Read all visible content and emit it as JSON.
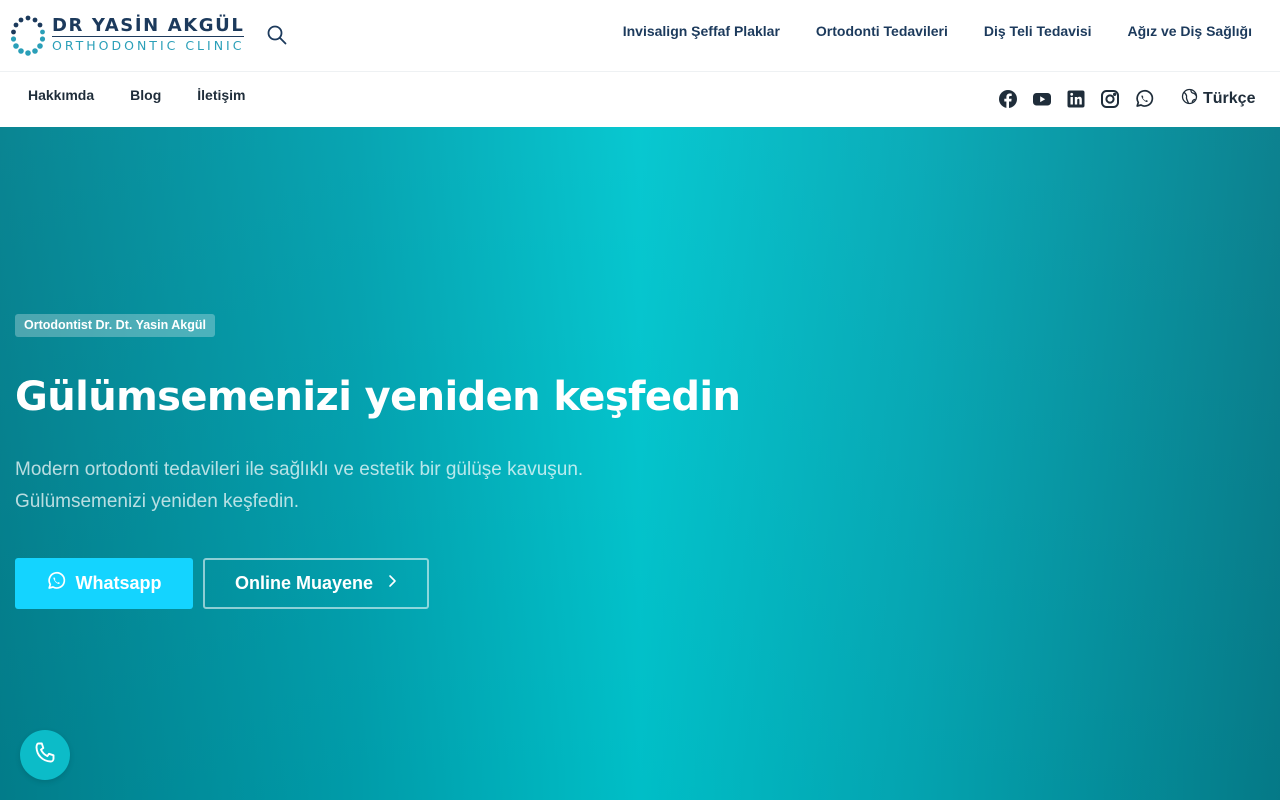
{
  "brand": {
    "title": "DR YASİN AKGÜL",
    "subtitle": "ORTHODONTIC CLINIC",
    "colors": {
      "navy": "#1c3a5c",
      "teal": "#2a9fb8"
    }
  },
  "header": {
    "search_icon": "search-icon",
    "main_nav": [
      {
        "label": "Invisalign Şeffaf Plaklar"
      },
      {
        "label": "Ortodonti Tedavileri"
      },
      {
        "label": "Diş Teli Tedavisi"
      },
      {
        "label": "Ağız ve Diş Sağlığı"
      }
    ],
    "sub_nav": [
      {
        "label": "Hakkımda"
      },
      {
        "label": "Blog"
      },
      {
        "label": "İletişim"
      }
    ],
    "socials": [
      "facebook-icon",
      "youtube-icon",
      "linkedin-icon",
      "instagram-icon",
      "whatsapp-icon"
    ],
    "language": {
      "icon": "globe-icon",
      "label": "Türkçe"
    }
  },
  "hero": {
    "badge": "Ortodontist Dr. Dt. Yasin Akgül",
    "title": "Gülümsemenizi yeniden keşfedin",
    "description_line1": "Modern ortodonti tedavileri ile sağlıklı ve estetik bir gülüşe kavuşun.",
    "description_line2": "Gülümsemenizi yeniden keşfedin.",
    "whatsapp_button": {
      "label": "Whatsapp",
      "icon": "whatsapp-icon",
      "color": "#14d4ff"
    },
    "online_button": {
      "label": "Online Muayene",
      "icon": "chevron-right-icon"
    },
    "gradient": [
      "#02818f",
      "#00c6cf",
      "#057e8c"
    ]
  },
  "floating_call": {
    "icon": "phone-icon",
    "color": "#0cbcc8"
  }
}
